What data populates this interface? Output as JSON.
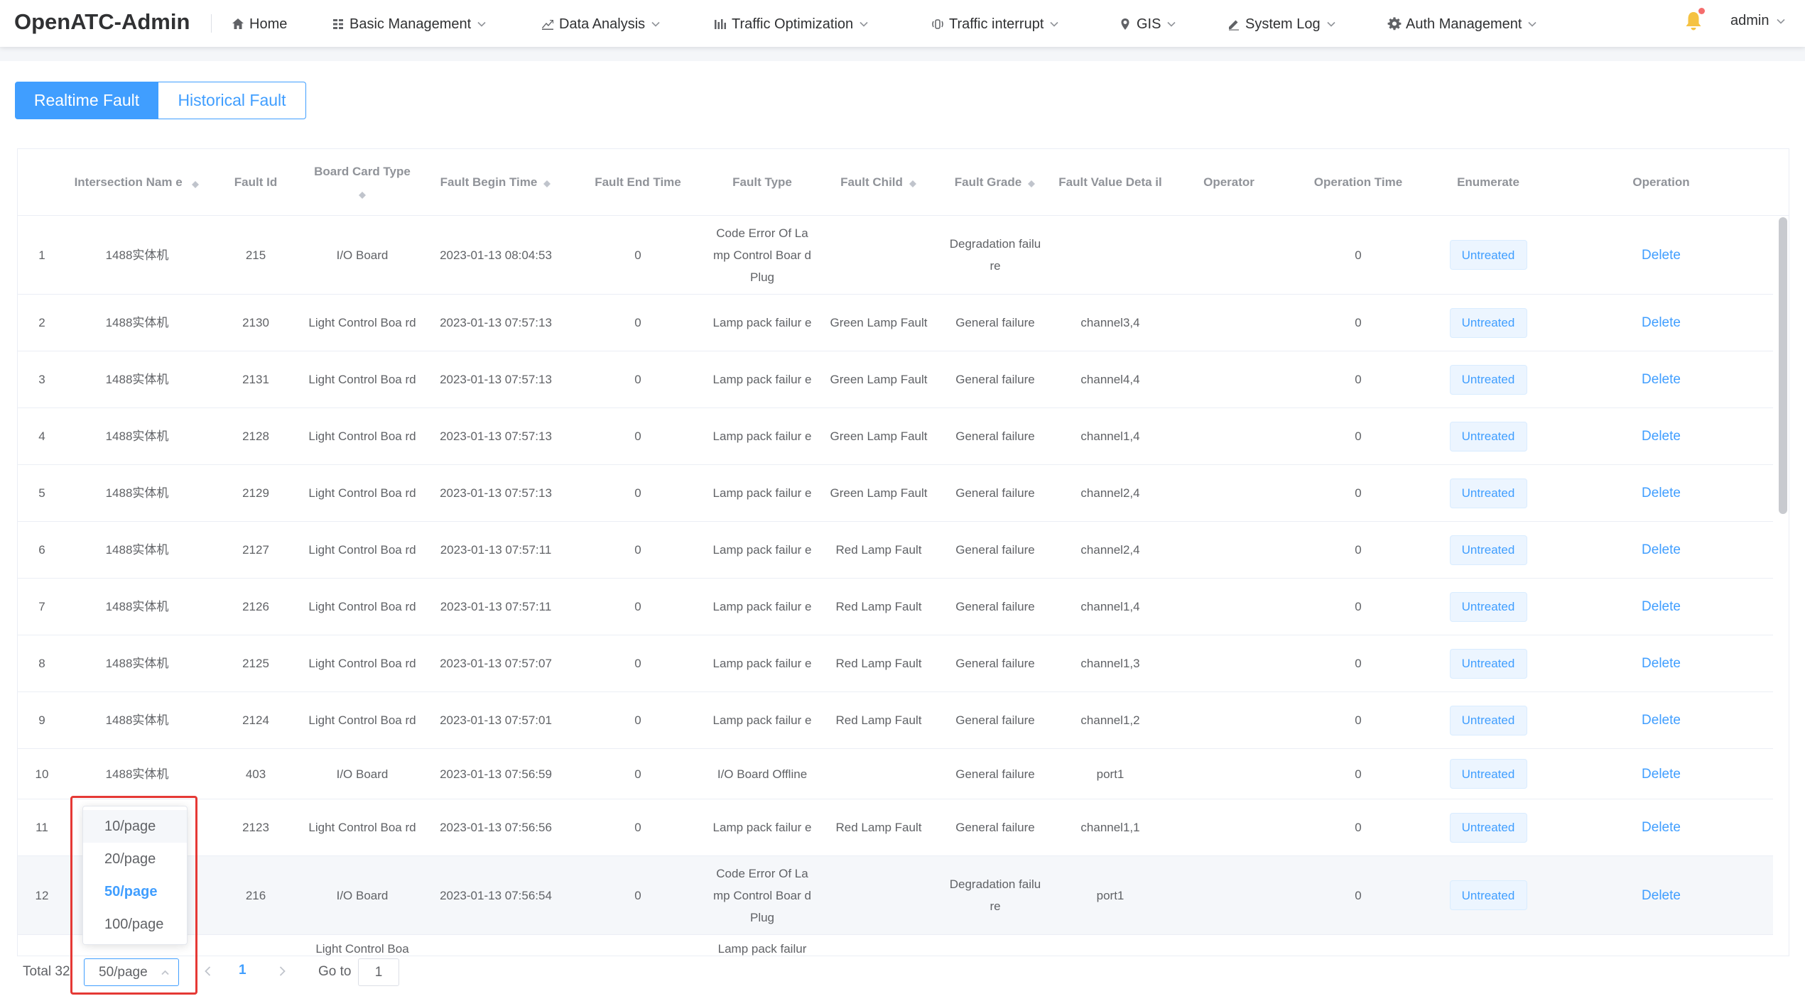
{
  "app": {
    "brand": "OpenATC-Admin"
  },
  "nav": [
    {
      "label": "Home",
      "icon": "home-icon",
      "dropdown": false
    },
    {
      "label": "Basic Management",
      "icon": "grid-icon",
      "dropdown": true
    },
    {
      "label": "Data Analysis",
      "icon": "chart-icon",
      "dropdown": true
    },
    {
      "label": "Traffic Optimization",
      "icon": "bars-icon",
      "dropdown": true
    },
    {
      "label": "Traffic interrupt",
      "icon": "signal-icon",
      "dropdown": true
    },
    {
      "label": "GIS",
      "icon": "location-icon",
      "dropdown": true
    },
    {
      "label": "System Log",
      "icon": "edit-icon",
      "dropdown": true
    },
    {
      "label": "Auth Management",
      "icon": "gear-icon",
      "dropdown": true
    }
  ],
  "user": {
    "name": "admin",
    "bell_color": "#f5c242"
  },
  "tabs": {
    "realtime": "Realtime Fault",
    "historical": "Historical Fault"
  },
  "table": {
    "headers": {
      "intersection": "Intersection Nam e",
      "fault_id": "Fault Id",
      "board": "Board Card Type",
      "begin": "Fault Begin Time",
      "end": "Fault End Time",
      "type": "Fault Type",
      "child": "Fault Child",
      "grade": "Fault Grade",
      "value": "Fault Value Deta il",
      "operator": "Operator",
      "op_time": "Operation Time",
      "enumerate": "Enumerate",
      "operation": "Operation"
    },
    "rows": [
      {
        "no": "1",
        "intersection": "1488实体机",
        "fault_id": "215",
        "board": "I/O Board",
        "begin": "2023-01-13 08:04:53",
        "end": "0",
        "type": "Code Error Of La mp Control Boar d Plug",
        "child": "",
        "grade": "Degradation failu re",
        "value": "",
        "operator": "",
        "op_time": "0",
        "status": "Untreated",
        "action": "Delete"
      },
      {
        "no": "2",
        "intersection": "1488实体机",
        "fault_id": "2130",
        "board": "Light Control Boa rd",
        "begin": "2023-01-13 07:57:13",
        "end": "0",
        "type": "Lamp pack failur e",
        "child": "Green Lamp Fault",
        "grade": "General failure",
        "value": "channel3,4",
        "operator": "",
        "op_time": "0",
        "status": "Untreated",
        "action": "Delete"
      },
      {
        "no": "3",
        "intersection": "1488实体机",
        "fault_id": "2131",
        "board": "Light Control Boa rd",
        "begin": "2023-01-13 07:57:13",
        "end": "0",
        "type": "Lamp pack failur e",
        "child": "Green Lamp Fault",
        "grade": "General failure",
        "value": "channel4,4",
        "operator": "",
        "op_time": "0",
        "status": "Untreated",
        "action": "Delete"
      },
      {
        "no": "4",
        "intersection": "1488实体机",
        "fault_id": "2128",
        "board": "Light Control Boa rd",
        "begin": "2023-01-13 07:57:13",
        "end": "0",
        "type": "Lamp pack failur e",
        "child": "Green Lamp Fault",
        "grade": "General failure",
        "value": "channel1,4",
        "operator": "",
        "op_time": "0",
        "status": "Untreated",
        "action": "Delete"
      },
      {
        "no": "5",
        "intersection": "1488实体机",
        "fault_id": "2129",
        "board": "Light Control Boa rd",
        "begin": "2023-01-13 07:57:13",
        "end": "0",
        "type": "Lamp pack failur e",
        "child": "Green Lamp Fault",
        "grade": "General failure",
        "value": "channel2,4",
        "operator": "",
        "op_time": "0",
        "status": "Untreated",
        "action": "Delete"
      },
      {
        "no": "6",
        "intersection": "1488实体机",
        "fault_id": "2127",
        "board": "Light Control Boa rd",
        "begin": "2023-01-13 07:57:11",
        "end": "0",
        "type": "Lamp pack failur e",
        "child": "Red Lamp Fault",
        "grade": "General failure",
        "value": "channel2,4",
        "operator": "",
        "op_time": "0",
        "status": "Untreated",
        "action": "Delete"
      },
      {
        "no": "7",
        "intersection": "1488实体机",
        "fault_id": "2126",
        "board": "Light Control Boa rd",
        "begin": "2023-01-13 07:57:11",
        "end": "0",
        "type": "Lamp pack failur e",
        "child": "Red Lamp Fault",
        "grade": "General failure",
        "value": "channel1,4",
        "operator": "",
        "op_time": "0",
        "status": "Untreated",
        "action": "Delete"
      },
      {
        "no": "8",
        "intersection": "1488实体机",
        "fault_id": "2125",
        "board": "Light Control Boa rd",
        "begin": "2023-01-13 07:57:07",
        "end": "0",
        "type": "Lamp pack failur e",
        "child": "Red Lamp Fault",
        "grade": "General failure",
        "value": "channel1,3",
        "operator": "",
        "op_time": "0",
        "status": "Untreated",
        "action": "Delete"
      },
      {
        "no": "9",
        "intersection": "1488实体机",
        "fault_id": "2124",
        "board": "Light Control Boa rd",
        "begin": "2023-01-13 07:57:01",
        "end": "0",
        "type": "Lamp pack failur e",
        "child": "Red Lamp Fault",
        "grade": "General failure",
        "value": "channel1,2",
        "operator": "",
        "op_time": "0",
        "status": "Untreated",
        "action": "Delete"
      },
      {
        "no": "10",
        "intersection": "1488实体机",
        "fault_id": "403",
        "board": "I/O Board",
        "begin": "2023-01-13 07:56:59",
        "end": "0",
        "type": "I/O Board Offline",
        "child": "",
        "grade": "General failure",
        "value": "port1",
        "operator": "",
        "op_time": "0",
        "status": "Untreated",
        "action": "Delete"
      },
      {
        "no": "11",
        "intersection": "",
        "fault_id": "2123",
        "board": "Light Control Boa rd",
        "begin": "2023-01-13 07:56:56",
        "end": "0",
        "type": "Lamp pack failur e",
        "child": "Red Lamp Fault",
        "grade": "General failure",
        "value": "channel1,1",
        "operator": "",
        "op_time": "0",
        "status": "Untreated",
        "action": "Delete"
      },
      {
        "no": "12",
        "intersection": "",
        "fault_id": "216",
        "board": "I/O Board",
        "begin": "2023-01-13 07:56:54",
        "end": "0",
        "type": "Code Error Of La mp Control Boar d Plug",
        "child": "",
        "grade": "Degradation failu re",
        "value": "port1",
        "operator": "",
        "op_time": "0",
        "status": "Untreated",
        "action": "Delete"
      },
      {
        "no": "",
        "intersection": "",
        "fault_id": "",
        "board": "Light Control Boa",
        "begin": "",
        "end": "",
        "type": "Lamp pack failur",
        "child": "",
        "grade": "",
        "value": "",
        "operator": "",
        "op_time": "",
        "status": "",
        "action": ""
      }
    ]
  },
  "pagination": {
    "total": "Total 32",
    "page_size": "50/page",
    "current_page": "1",
    "goto_label": "Go to",
    "goto_value": "1",
    "options": [
      "10/page",
      "20/page",
      "50/page",
      "100/page"
    ],
    "selected_option": "50/page"
  },
  "colors": {
    "accent": "#409eff",
    "highlight": "#e53935",
    "notice": "#f56c6c"
  }
}
